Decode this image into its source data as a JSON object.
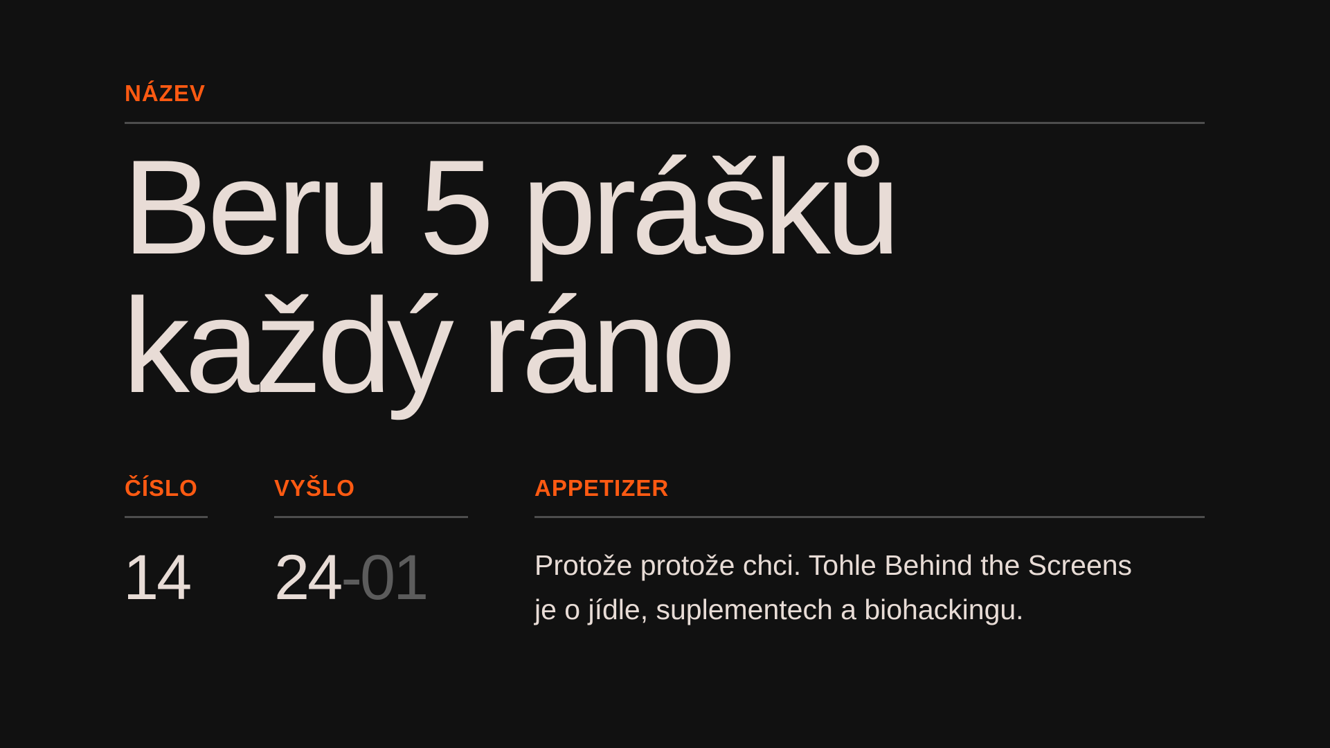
{
  "title_section": {
    "label": "NÁZEV",
    "headline_line1": "Beru 5 prášků",
    "headline_line2": "každý ráno"
  },
  "issue": {
    "label": "ČÍSLO",
    "value": "14"
  },
  "published": {
    "label": "VYŠLO",
    "year": "24",
    "separator": "-",
    "month": "01"
  },
  "appetizer": {
    "label": "APPETIZER",
    "text_line1": "Protože protože chci. Tohle Behind the Screens",
    "text_line2": "je o jídle, suplementech a biohackingu."
  },
  "colors": {
    "background": "#111111",
    "accent": "#ff5a12",
    "text": "#e8dcd6",
    "muted": "#5c5c5c",
    "rule": "#4d4d4d"
  }
}
